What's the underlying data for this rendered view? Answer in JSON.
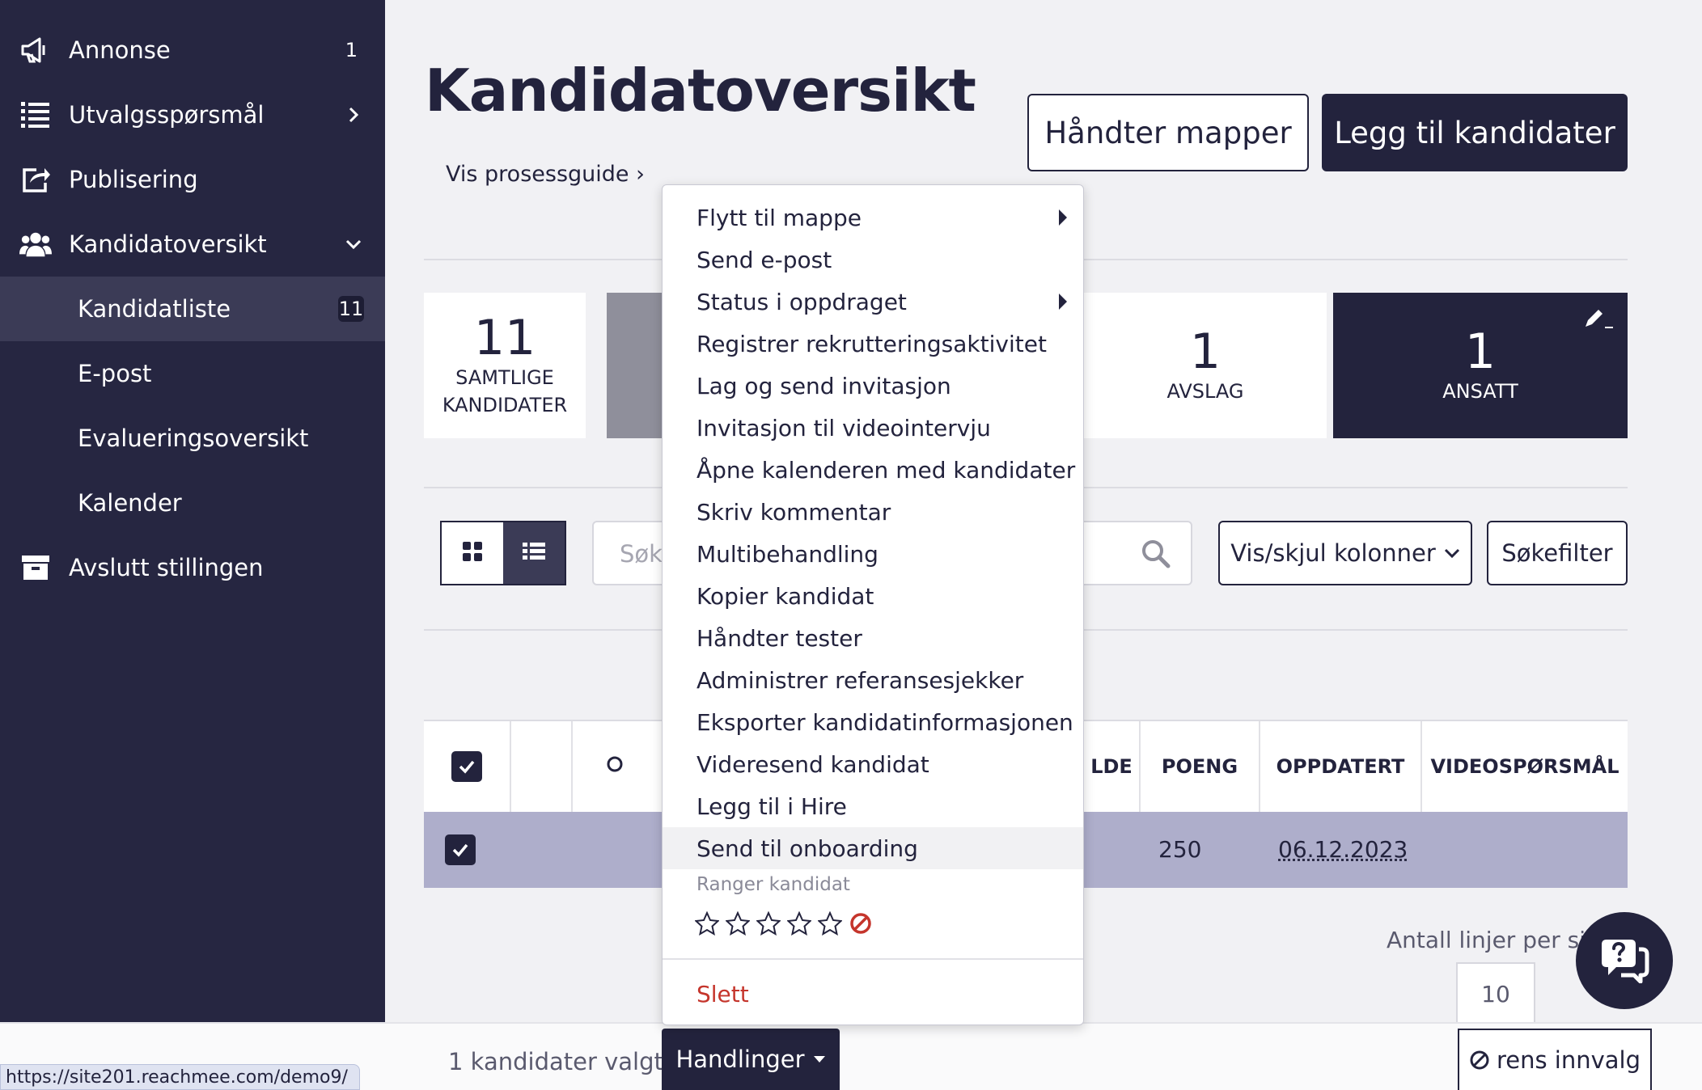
{
  "sidebar": {
    "items": [
      {
        "label": "Annonse",
        "count": "1",
        "icon": "megaphone-icon"
      },
      {
        "label": "Utvalgsspørsmål",
        "icon": "list-icon"
      },
      {
        "label": "Publisering",
        "icon": "share-icon"
      },
      {
        "label": "Kandidatoversikt",
        "icon": "users-icon"
      },
      {
        "label": "Kandidatliste",
        "count": "11"
      },
      {
        "label": "E-post"
      },
      {
        "label": "Evalueringsoversikt"
      },
      {
        "label": "Kalender"
      },
      {
        "label": "Avslutt stillingen",
        "icon": "archive-icon"
      }
    ]
  },
  "header": {
    "title": "Kandidatoversikt",
    "guide_link": "Vis prosessguide ›",
    "manage_folders": "Håndter mapper",
    "add_candidates": "Legg til kandidater"
  },
  "stats": [
    {
      "num": "11",
      "label": "SAMTLIGE KANDIDATER"
    },
    {
      "num": "1",
      "label": "AVSLAG"
    },
    {
      "num": "1",
      "label": "ANSATT"
    }
  ],
  "toolbar": {
    "search_placeholder": "Søk",
    "columns_button": "Vis/skjul kolonner",
    "filter_button": "Søkefilter"
  },
  "table": {
    "headers": [
      "LDE",
      "POENG",
      "OPPDATERT",
      "VIDEOSPØRSMÅL"
    ],
    "rows": [
      {
        "points": "250",
        "updated": "06.12.2023"
      }
    ]
  },
  "pagination": {
    "label": "Antall linjer per sid",
    "value": "10"
  },
  "bottom": {
    "selected": "1 kandidater valgt",
    "actions": "Handlinger",
    "clear": "rens innvalg",
    "url": "https://site201.reachmee.com/demo9/"
  },
  "menu": {
    "items": [
      {
        "label": "Flytt til mappe",
        "submenu": true
      },
      {
        "label": "Send e-post"
      },
      {
        "label": "Status i oppdraget",
        "submenu": true
      },
      {
        "label": "Registrer rekrutteringsaktivitet"
      },
      {
        "label": "Lag og send invitasjon"
      },
      {
        "label": "Invitasjon til videointervju"
      },
      {
        "label": "Åpne kalenderen med kandidater"
      },
      {
        "label": "Skriv kommentar"
      },
      {
        "label": "Multibehandling"
      },
      {
        "label": "Kopier kandidat"
      },
      {
        "label": "Håndter tester"
      },
      {
        "label": "Administrer referansesjekker"
      },
      {
        "label": "Eksporter kandidatinformasjonen"
      },
      {
        "label": "Videresend kandidat"
      },
      {
        "label": "Legg til i Hire"
      },
      {
        "label": "Send til onboarding"
      }
    ],
    "rank_label": "Ranger kandidat",
    "delete": "Slett"
  },
  "colors": {
    "navy": "#23233d",
    "sidebar": "#262641",
    "selected_row": "#aeaecb",
    "danger": "#c5352c"
  }
}
